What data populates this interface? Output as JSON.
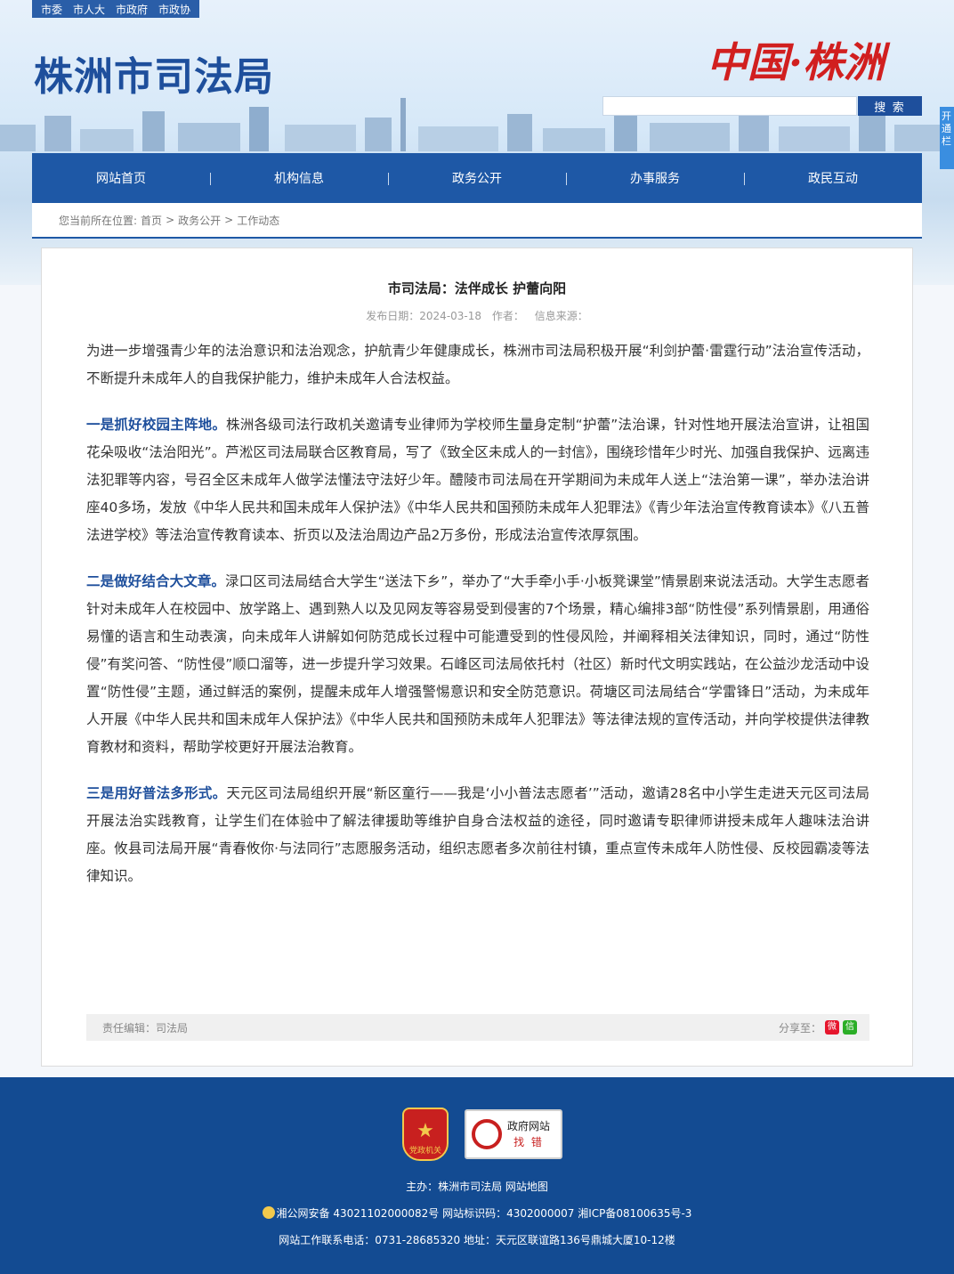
{
  "topbar": {
    "links": [
      "市委",
      "市人大",
      "市政府",
      "市政协"
    ]
  },
  "header": {
    "logo": "株洲市司法局",
    "brand": "中国·株洲",
    "search_button": "搜 索",
    "side_tab": "开通栏"
  },
  "nav": {
    "items": [
      "网站首页",
      "机构信息",
      "政务公开",
      "办事服务",
      "政民互动"
    ]
  },
  "breadcrumb": {
    "prefix": "您当前所在位置:",
    "items": [
      "首页",
      ">",
      "政务公开",
      ">",
      "工作动态"
    ]
  },
  "article": {
    "title": "市司法局：法伴成长 护蕾向阳",
    "date_label": "发布日期：2024-03-18",
    "author_label": "作者：",
    "source_label": "信息来源：",
    "intro": "为进一步增强青少年的法治意识和法治观念，护航青少年健康成长，株洲市司法局积极开展“利剑护蕾·雷霆行动”法治宣传活动，不断提升未成年人的自我保护能力，维护未成年人合法权益。",
    "sections": [
      {
        "lead": "一是抓好校园主阵地。",
        "text": "株洲各级司法行政机关邀请专业律师为学校师生量身定制“护蕾”法治课，针对性地开展法治宣讲，让祖国花朵吸收“法治阳光”。芦淞区司法局联合区教育局，写了《致全区未成人的一封信》，围绕珍惜年少时光、加强自我保护、远离违法犯罪等内容，号召全区未成年人做学法懂法守法好少年。醴陵市司法局在开学期间为未成年人送上“法治第一课”，举办法治讲座40多场，发放《中华人民共和国未成年人保护法》《中华人民共和国预防未成年人犯罪法》《青少年法治宣传教育读本》《八五普法进学校》等法治宣传教育读本、折页以及法治周边产品2万多份，形成法治宣传浓厚氛围。"
      },
      {
        "lead": "二是做好结合大文章。",
        "text": "渌口区司法局结合大学生“送法下乡”，举办了“大手牵小手·小板凳课堂”情景剧来说法活动。大学生志愿者针对未成年人在校园中、放学路上、遇到熟人以及见网友等容易受到侵害的7个场景，精心编排3部“防性侵”系列情景剧，用通俗易懂的语言和生动表演，向未成年人讲解如何防范成长过程中可能遭受到的性侵风险，并阐释相关法律知识，同时，通过“防性侵”有奖问答、“防性侵”顺口溜等，进一步提升学习效果。石峰区司法局依托村（社区）新时代文明实践站，在公益沙龙活动中设置“防性侵”主题，通过鲜活的案例，提醒未成年人增强警惕意识和安全防范意识。荷塘区司法局结合“学雷锋日”活动，为未成年人开展《中华人民共和国未成年人保护法》《中华人民共和国预防未成年人犯罪法》等法律法规的宣传活动，并向学校提供法律教育教材和资料，帮助学校更好开展法治教育。"
      },
      {
        "lead": "三是用好普法多形式。",
        "text": "天元区司法局组织开展“新区童行——我是‘小小普法志愿者’”活动，邀请28名中小学生走进天元区司法局开展法治实践教育，让学生们在体验中了解法律援助等维护自身合法权益的途径，同时邀请专职律师讲授未成年人趣味法治讲座。攸县司法局开展“青春攸你·与法同行”志愿服务活动，组织志愿者多次前往村镇，重点宣传未成年人防性侵、反校园霸凌等法律知识。"
      }
    ],
    "editor_label": "责任编辑：司法局",
    "share_label": "分享至："
  },
  "footer": {
    "party_badge": "党政机关",
    "error_badge_top": "政府网站",
    "error_badge_bottom": "找 错",
    "host": "主办：株洲市司法局 网站地图",
    "icp": "湘公网安备 43021102000082号 网站标识码：4302000007 湘ICP备08100635号-3",
    "contact": "网站工作联系电话：0731-28685320 地址：天元区联谊路136号鼎城大厦10-12楼"
  },
  "colors": {
    "primary": "#1e58a6",
    "footer_bg": "#134b92",
    "lead_text": "#1e4f9c",
    "brand_red": "#d11f1f"
  }
}
